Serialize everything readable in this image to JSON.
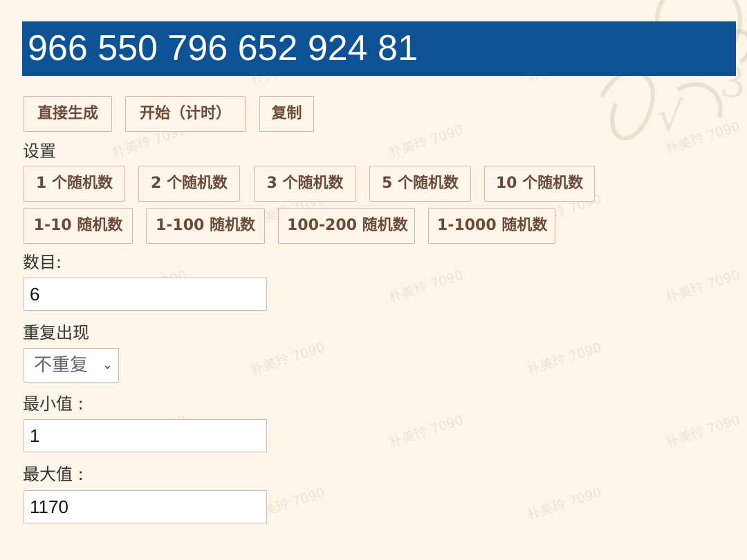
{
  "result": {
    "numbers": "966 550 796 652 924 81"
  },
  "actions": {
    "generate": "直接生成",
    "start_timed": "开始（计时）",
    "copy": "复制"
  },
  "settings": {
    "heading": "设置",
    "presets_row1": [
      "1 个随机数",
      "2 个随机数",
      "3 个随机数",
      "5 个随机数",
      "10 个随机数"
    ],
    "presets_row2": [
      "1-10 随机数",
      "1-100 随机数",
      "100-200 随机数",
      "1-1000 随机数"
    ]
  },
  "form": {
    "count_label": "数目:",
    "count_value": "6",
    "repeat_label": "重复出现",
    "repeat_selected": "不重复",
    "min_label": "最小值  :",
    "min_value": "1",
    "max_label": "最大值  :",
    "max_value": "1170"
  },
  "watermark": "朴美玲 7090",
  "colors": {
    "result_bg": "#0d5294",
    "page_bg": "#fcf5e8",
    "button_text": "#6b4a38",
    "border": "#d2b8a8"
  }
}
